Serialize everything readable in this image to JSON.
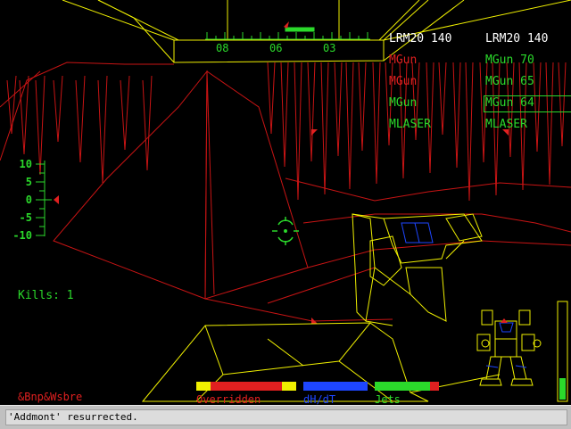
{
  "colors": {
    "hud_green": "#2bd92b",
    "wire_yellow": "#f0f000",
    "wire_red": "#c81414",
    "enemy_red": "#e02020",
    "heat_blue": "#1e46ff",
    "console_text": "#2ba82b"
  },
  "compass": {
    "labels": [
      "08",
      "06",
      "03"
    ]
  },
  "pitch_ladder": {
    "labels": [
      "10",
      "5",
      "0",
      "-5",
      "-10"
    ]
  },
  "weapons": {
    "left": [
      {
        "label": "LRM20 140",
        "state": "ready"
      },
      {
        "label": "MGun",
        "state": "disabled"
      },
      {
        "label": "MGun",
        "state": "disabled"
      },
      {
        "label": "MGun",
        "state": "ready"
      },
      {
        "label": "MLASER",
        "state": "ready"
      }
    ],
    "right": [
      {
        "label": "LRM20 140",
        "state": "ready"
      },
      {
        "label": "MGun 70",
        "state": "ready"
      },
      {
        "label": "MGun 65",
        "state": "ready"
      },
      {
        "label": "MGun 64",
        "state": "selected"
      },
      {
        "label": "MLASER",
        "state": "ready"
      }
    ]
  },
  "kills": {
    "text": "Kills: 1"
  },
  "player_name": "&Bnp&Wsbre",
  "status_bars": [
    {
      "label": "Overridden",
      "fill": 1.0
    },
    {
      "label": "dH/dT",
      "fill": 1.0
    },
    {
      "label": "Jets",
      "fill": 0.87
    }
  ],
  "throttle": {
    "level": 0.22
  },
  "console": {
    "message": "'Addmont' resurrected."
  }
}
